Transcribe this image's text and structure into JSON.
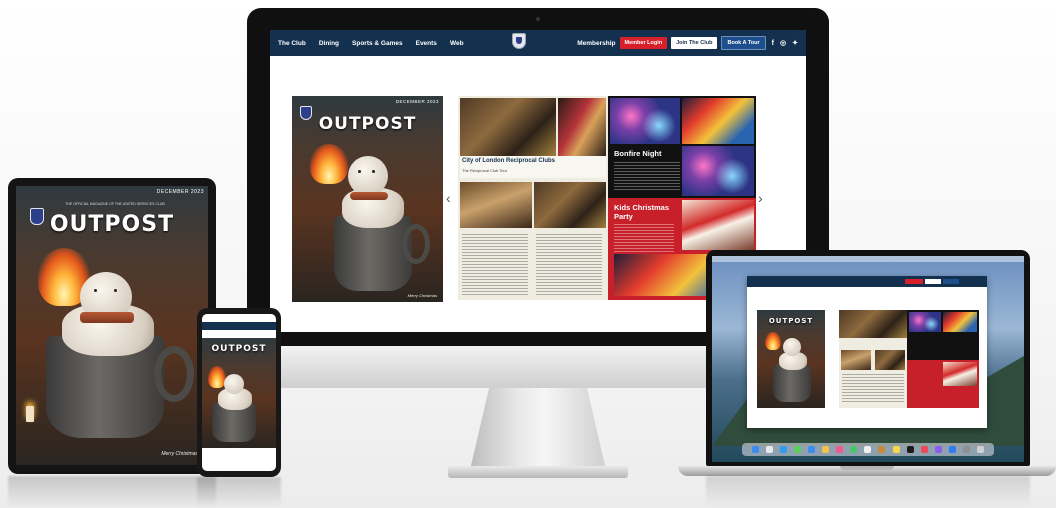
{
  "site_nav": {
    "links": [
      "The Club",
      "Dining",
      "Sports & Games",
      "Events",
      "Web"
    ],
    "membership": "Membership",
    "member_login": "Member Login",
    "join_club": "Join The Club",
    "book_tour": "Book A Tour",
    "social_icons": [
      "facebook-icon",
      "instagram-icon",
      "twitter-icon"
    ]
  },
  "magazine": {
    "title": "OUTPOST",
    "month": "DECEMBER 2023",
    "tagline": "THE OFFICIAL MAGAZINE OF THE UNITED SERVICES CLUB",
    "signature": "Merry Christmas"
  },
  "spread": {
    "article_title": "City of London Reciprocal Clubs",
    "article_sub": "The Reciprocal Club Tour",
    "bonfire_title": "Bonfire Night",
    "christmas_title": "Kids Christmas Party"
  },
  "colors": {
    "nav_bg": "#14304f",
    "brand_red": "#d8202a",
    "accent_blue": "#1d4f8d"
  }
}
